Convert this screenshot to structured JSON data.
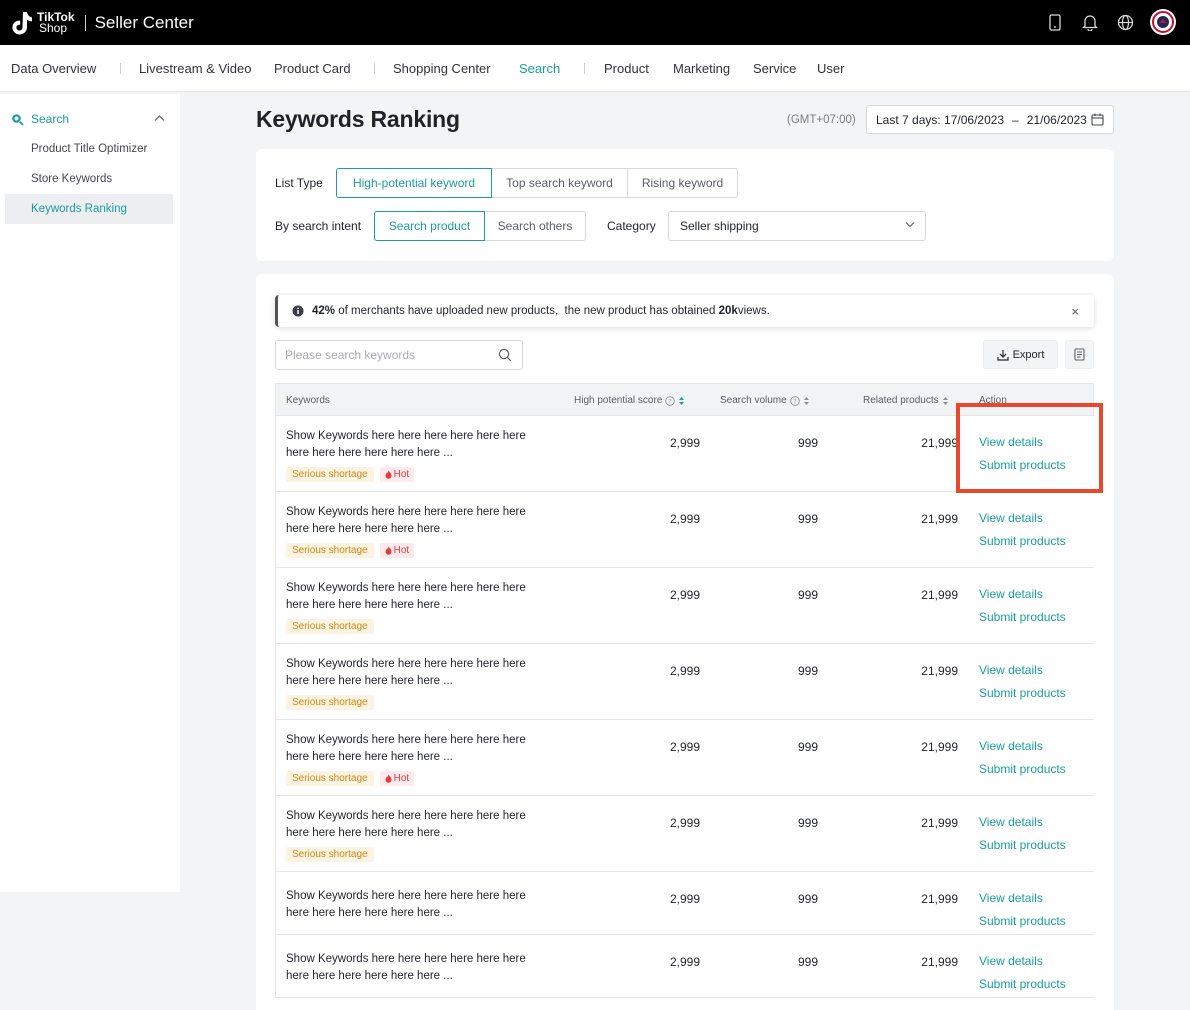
{
  "topbar": {
    "logo_line1": "TikTok",
    "logo_line2": "Shop",
    "app_title": "Seller Center"
  },
  "nav": {
    "items": [
      {
        "label": "Data Overview"
      },
      {
        "label": "Livestream & Video"
      },
      {
        "label": "Product Card"
      },
      {
        "label": "Shopping Center"
      },
      {
        "label": "Search"
      },
      {
        "label": "Product"
      },
      {
        "label": "Marketing"
      },
      {
        "label": "Service"
      },
      {
        "label": "User"
      }
    ],
    "active": "Search"
  },
  "sidebar": {
    "section": "Search",
    "items": [
      {
        "label": "Product Title Optimizer"
      },
      {
        "label": "Store Keywords"
      },
      {
        "label": "Keywords Ranking"
      }
    ],
    "active": "Keywords Ranking"
  },
  "page": {
    "title": "Keywords Ranking",
    "timezone": "(GMT+07:00)",
    "date_label": "Last 7 days: 17/06/2023",
    "date_dash": "–",
    "date_end": "21/06/2023"
  },
  "filters": {
    "list_type_label": "List Type",
    "list_types": [
      "High-potential keyword",
      "Top search keyword",
      "Rising keyword"
    ],
    "list_type_selected": "High-potential keyword",
    "intent_label": "By search intent",
    "intents": [
      "Search product",
      "Search others"
    ],
    "intent_selected": "Search product",
    "category_label": "Category",
    "category_value": "Seller shipping"
  },
  "notice": {
    "pct": "42%",
    "text1": " of merchants have uploaded new products,  the new product has obtained ",
    "views": "20k",
    "text2": " views.",
    "close": "×"
  },
  "toolbar": {
    "search_placeholder": "Please search keywords",
    "export_label": "Export"
  },
  "table": {
    "columns": {
      "keywords": "Keywords",
      "score": "High potential score",
      "volume": "Search volume",
      "related": "Related products",
      "action": "Action"
    },
    "rows": [
      {
        "keyword": "Show Keywords here here here here here here here here here here here here ...",
        "shortage": "Serious shortage",
        "hot": "Hot",
        "score": "2,999",
        "volume": "999",
        "related": "21,999",
        "view": "View details",
        "submit": "Submit products"
      },
      {
        "keyword": "Show Keywords here here here here here here here here here here here here ...",
        "shortage": "Serious shortage",
        "hot": "Hot",
        "score": "2,999",
        "volume": "999",
        "related": "21,999",
        "view": "View details",
        "submit": "Submit products"
      },
      {
        "keyword": "Show Keywords here here here here here here here here here here here here ...",
        "shortage": "Serious shortage",
        "hot": "",
        "score": "2,999",
        "volume": "999",
        "related": "21,999",
        "view": "View details",
        "submit": "Submit products"
      },
      {
        "keyword": "Show Keywords here here here here here here here here here here here here ...",
        "shortage": "Serious shortage",
        "hot": "",
        "score": "2,999",
        "volume": "999",
        "related": "21,999",
        "view": "View details",
        "submit": "Submit products"
      },
      {
        "keyword": "Show Keywords here here here here here here here here here here here here ...",
        "shortage": "Serious shortage",
        "hot": "Hot",
        "score": "2,999",
        "volume": "999",
        "related": "21,999",
        "view": "View details",
        "submit": "Submit products"
      },
      {
        "keyword": "Show Keywords here here here here here here here here here here here here ...",
        "shortage": "Serious shortage",
        "hot": "",
        "score": "2,999",
        "volume": "999",
        "related": "21,999",
        "view": "View details",
        "submit": "Submit products"
      },
      {
        "keyword": "Show Keywords here here here here here here here here here here here here ...",
        "shortage": "",
        "hot": "",
        "score": "2,999",
        "volume": "999",
        "related": "21,999",
        "view": "View details",
        "submit": "Submit products"
      },
      {
        "keyword": "Show Keywords here here here here here here here here here here here here ...",
        "shortage": "",
        "hot": "",
        "score": "2,999",
        "volume": "999",
        "related": "21,999",
        "view": "View details",
        "submit": "Submit products"
      }
    ]
  },
  "colors": {
    "accent": "#1a9e9e",
    "highlight": "#e8492e",
    "shortage": "#c98a12",
    "hot": "#e23b46"
  }
}
